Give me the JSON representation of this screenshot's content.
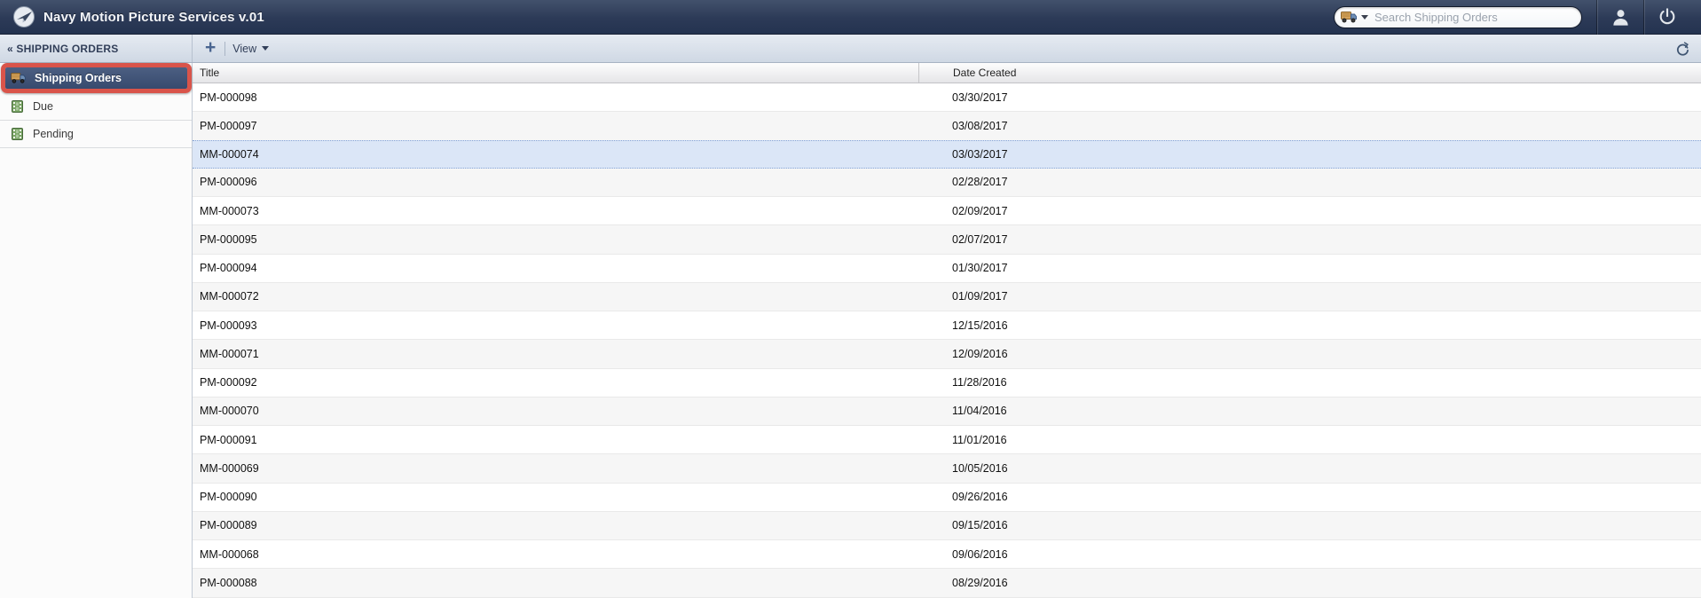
{
  "app": {
    "title": "Navy Motion Picture Services v.01"
  },
  "header": {
    "search": {
      "placeholder": "Search Shipping Orders"
    }
  },
  "toolbar": {
    "back_label": "« SHIPPING ORDERS",
    "add_label": "+",
    "view_label": "View"
  },
  "sidebar": {
    "annotation_color": "#d9544a",
    "items": [
      {
        "label": "Shipping Orders",
        "icon": "truck-icon",
        "selected": true,
        "annotated": true
      },
      {
        "label": "Due",
        "icon": "film-icon",
        "selected": false
      },
      {
        "label": "Pending",
        "icon": "film-icon",
        "selected": false
      }
    ]
  },
  "table": {
    "columns": [
      "Title",
      "Date Created"
    ],
    "rows": [
      {
        "title": "PM-000098",
        "date": "03/30/2017"
      },
      {
        "title": "PM-000097",
        "date": "03/08/2017"
      },
      {
        "title": "MM-000074",
        "date": "03/03/2017",
        "selected": true
      },
      {
        "title": "PM-000096",
        "date": "02/28/2017"
      },
      {
        "title": "MM-000073",
        "date": "02/09/2017"
      },
      {
        "title": "PM-000095",
        "date": "02/07/2017"
      },
      {
        "title": "PM-000094",
        "date": "01/30/2017"
      },
      {
        "title": "MM-000072",
        "date": "01/09/2017"
      },
      {
        "title": "PM-000093",
        "date": "12/15/2016"
      },
      {
        "title": "MM-000071",
        "date": "12/09/2016"
      },
      {
        "title": "PM-000092",
        "date": "11/28/2016"
      },
      {
        "title": "MM-000070",
        "date": "11/04/2016"
      },
      {
        "title": "PM-000091",
        "date": "11/01/2016"
      },
      {
        "title": "MM-000069",
        "date": "10/05/2016"
      },
      {
        "title": "PM-000090",
        "date": "09/26/2016"
      },
      {
        "title": "PM-000089",
        "date": "09/15/2016"
      },
      {
        "title": "MM-000068",
        "date": "09/06/2016"
      },
      {
        "title": "PM-000088",
        "date": "08/29/2016"
      }
    ]
  }
}
